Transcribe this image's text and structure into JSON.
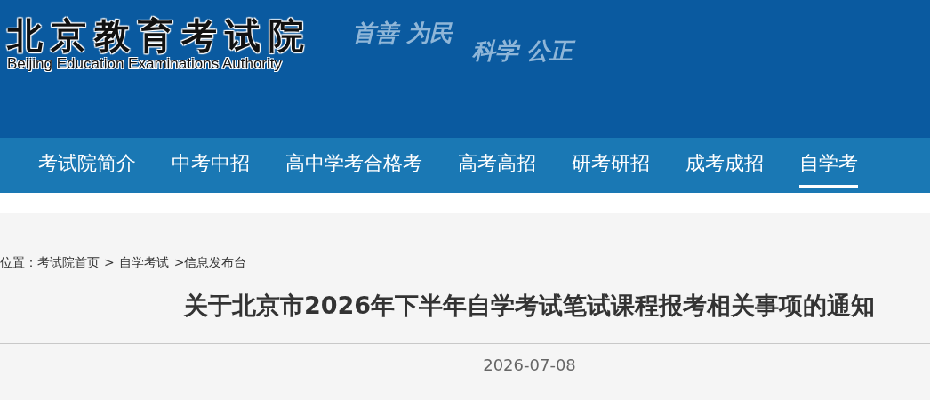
{
  "header": {
    "logo_title": "北京教育考试院",
    "logo_subtitle": "Beijing Education Examinations Authority",
    "slogans": [
      "首善 为民",
      "科学 公正"
    ]
  },
  "nav": [
    {
      "label": "考试院简介",
      "selected": false
    },
    {
      "label": "中考中招",
      "selected": false
    },
    {
      "label": "高中学考合格考",
      "selected": false
    },
    {
      "label": "高考高招",
      "selected": false
    },
    {
      "label": "研考研招",
      "selected": false
    },
    {
      "label": "成考成招",
      "selected": false
    },
    {
      "label": "自学考",
      "selected": true
    }
  ],
  "breadcrumb": {
    "prefix": "位置：",
    "links": [
      "考试院首页",
      "自学考试"
    ],
    "current": "信息发布台",
    "separator": ">"
  },
  "article": {
    "title": "关于北京市2026年下半年自学考试笔试课程报考相关事项的通知",
    "date": "2026-07-08"
  }
}
